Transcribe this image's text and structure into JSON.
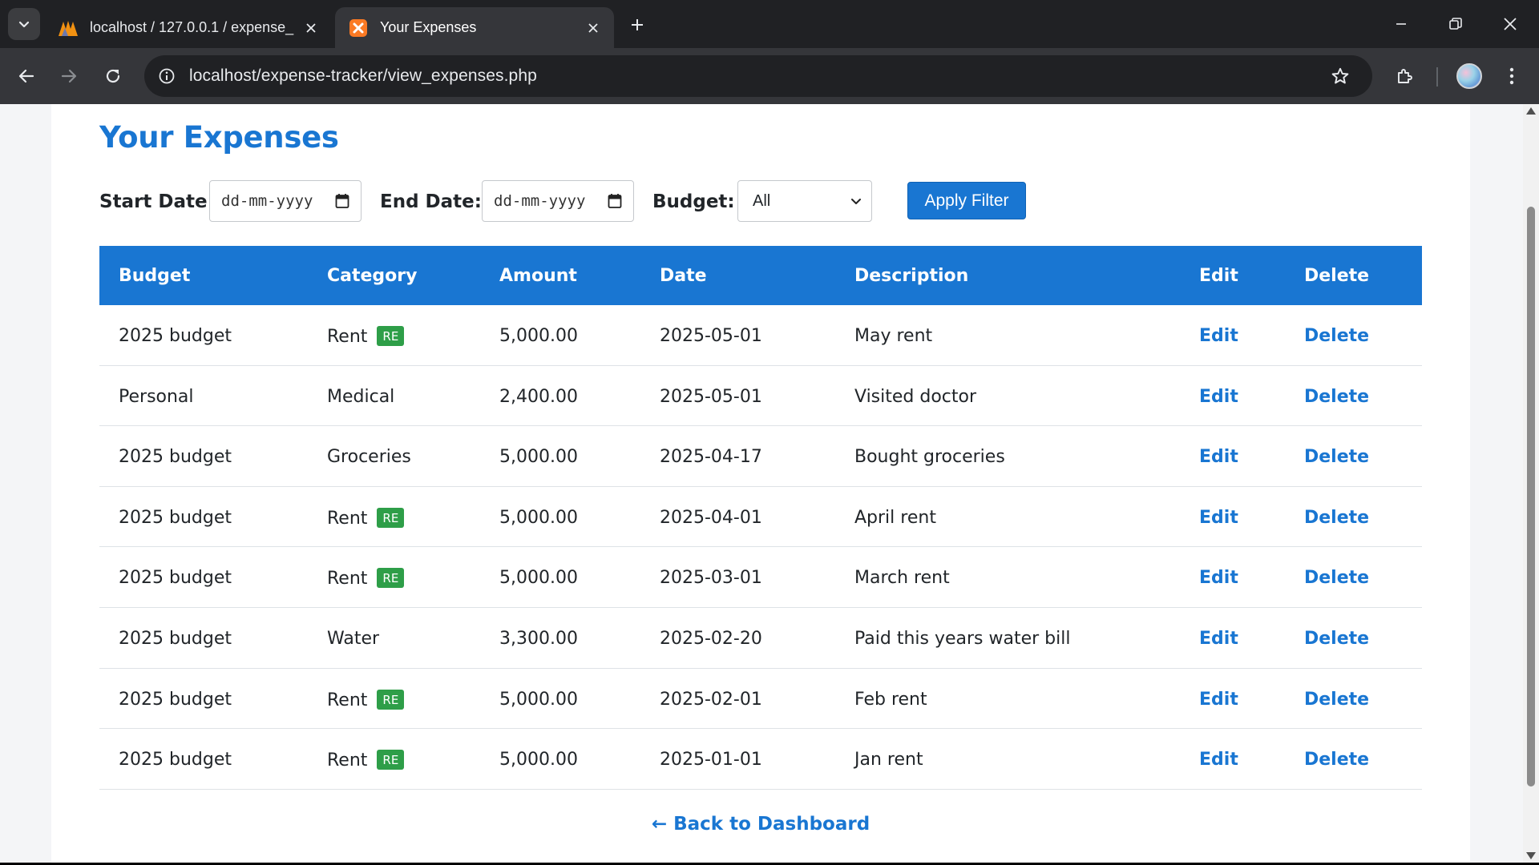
{
  "browser": {
    "tabs": [
      {
        "title": "localhost / 127.0.0.1 / expense_"
      },
      {
        "title": "Your Expenses"
      }
    ],
    "url": "localhost/expense-tracker/view_expenses.php"
  },
  "page": {
    "title": "Your Expenses",
    "filter": {
      "start_label": "Start Date:",
      "start_placeholder": "dd-mm-yyyy",
      "end_label": "End Date:",
      "end_placeholder": "dd-mm-yyyy",
      "budget_label": "Budget:",
      "budget_value": "All",
      "apply_label": "Apply Filter"
    },
    "table": {
      "headers": [
        "Budget",
        "Category",
        "Amount",
        "Date",
        "Description",
        "Edit",
        "Delete"
      ],
      "rows": [
        {
          "budget": "2025 budget",
          "category": "Rent",
          "badge": "RE",
          "amount": "5,000.00",
          "date": "2025-05-01",
          "description": "May rent",
          "edit": "Edit",
          "delete": "Delete"
        },
        {
          "budget": "Personal",
          "category": "Medical",
          "badge": "",
          "amount": "2,400.00",
          "date": "2025-05-01",
          "description": "Visited doctor",
          "edit": "Edit",
          "delete": "Delete"
        },
        {
          "budget": "2025 budget",
          "category": "Groceries",
          "badge": "",
          "amount": "5,000.00",
          "date": "2025-04-17",
          "description": "Bought groceries",
          "edit": "Edit",
          "delete": "Delete"
        },
        {
          "budget": "2025 budget",
          "category": "Rent",
          "badge": "RE",
          "amount": "5,000.00",
          "date": "2025-04-01",
          "description": "April rent",
          "edit": "Edit",
          "delete": "Delete"
        },
        {
          "budget": "2025 budget",
          "category": "Rent",
          "badge": "RE",
          "amount": "5,000.00",
          "date": "2025-03-01",
          "description": "March rent",
          "edit": "Edit",
          "delete": "Delete"
        },
        {
          "budget": "2025 budget",
          "category": "Water",
          "badge": "",
          "amount": "3,300.00",
          "date": "2025-02-20",
          "description": "Paid this years water bill",
          "edit": "Edit",
          "delete": "Delete"
        },
        {
          "budget": "2025 budget",
          "category": "Rent",
          "badge": "RE",
          "amount": "5,000.00",
          "date": "2025-02-01",
          "description": "Feb rent",
          "edit": "Edit",
          "delete": "Delete"
        },
        {
          "budget": "2025 budget",
          "category": "Rent",
          "badge": "RE",
          "amount": "5,000.00",
          "date": "2025-01-01",
          "description": "Jan rent",
          "edit": "Edit",
          "delete": "Delete"
        }
      ]
    },
    "back_link": "← Back to Dashboard"
  },
  "colors": {
    "accent": "#1976d2",
    "badge_green": "#2e9e48",
    "chrome_dark": "#202124",
    "chrome_toolbar": "#35363a"
  },
  "icons": [
    "tab-list-icon",
    "phpmyadmin-favicon-icon",
    "xampp-favicon-icon",
    "close-icon",
    "plus-icon",
    "minimize-icon",
    "restore-icon",
    "back-arrow-icon",
    "forward-arrow-icon",
    "reload-icon",
    "site-info-icon",
    "star-icon",
    "extensions-icon",
    "profile-avatar",
    "more-menu-icon",
    "calendar-icon",
    "chevron-down-icon"
  ]
}
